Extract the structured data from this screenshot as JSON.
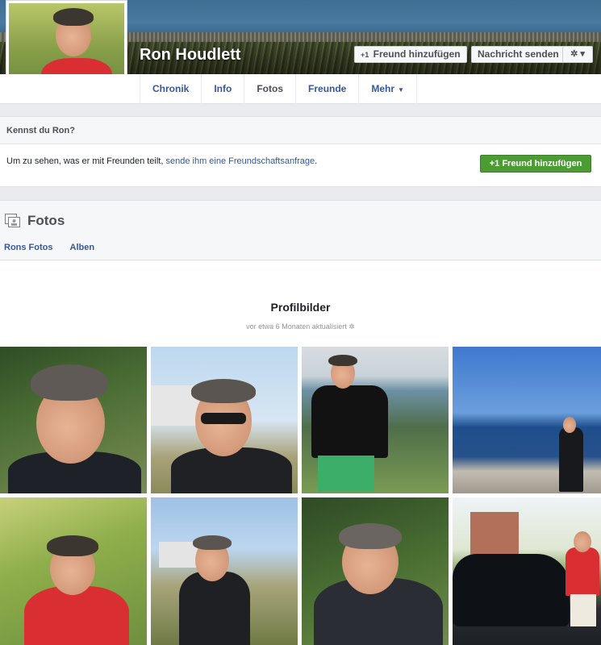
{
  "profile": {
    "name": "Ron Houdlett"
  },
  "cover_actions": {
    "add_friend_icon": "+1",
    "add_friend_label": "Freund hinzufügen",
    "message_label": "Nachricht senden",
    "gear_label": "✲ ▾"
  },
  "nav": {
    "tabs": [
      {
        "label": "Chronik"
      },
      {
        "label": "Info"
      },
      {
        "label": "Fotos"
      },
      {
        "label": "Freunde"
      },
      {
        "label": "Mehr"
      }
    ],
    "active_tab": "Fotos"
  },
  "know": {
    "heading": "Kennst du Ron?",
    "text_prefix": "Um zu sehen, was er mit Freunden teilt,",
    "link_text": "sende ihm eine Freundschaftsanfrage",
    "text_suffix": ".",
    "button_icon": "+1",
    "button_label": "Freund hinzufügen"
  },
  "photos": {
    "title": "Fotos",
    "sub_tabs": [
      "Rons Fotos",
      "Alben"
    ],
    "album_title": "Profilbilder",
    "album_updated": "vor etwa 6 Monaten aktualisiert",
    "album_updated_icon": "✲"
  },
  "colors": {
    "link": "#365899",
    "green_button": "#4b9d33",
    "page_gray": "#e9ebee"
  }
}
